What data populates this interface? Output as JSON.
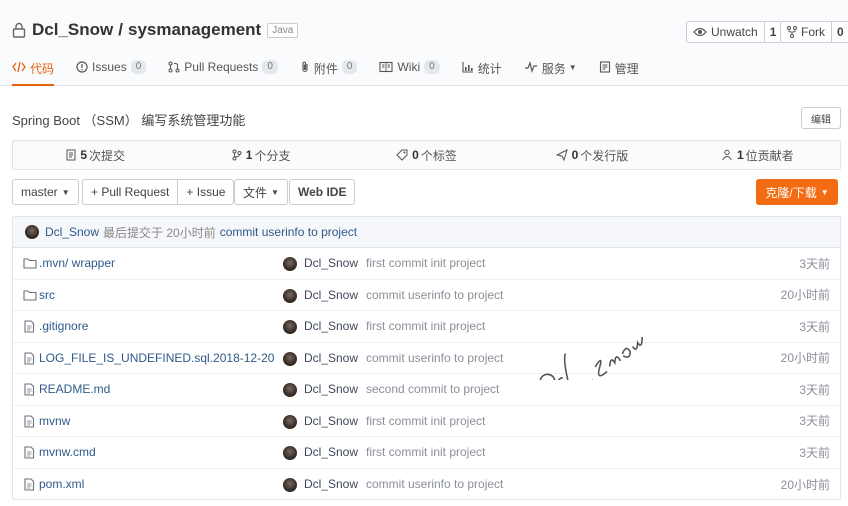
{
  "repo": {
    "owner": "Dcl_Snow",
    "separator": "/",
    "name": "sysmanagement",
    "language": "Java"
  },
  "actions": {
    "watch_label": "Unwatch",
    "watch_count": "1",
    "fork_label": "Fork",
    "fork_count": "0"
  },
  "tabs": [
    {
      "label": "代码",
      "icon": "code-icon"
    },
    {
      "label": "Issues",
      "badge": "0",
      "icon": "issue-icon"
    },
    {
      "label": "Pull Requests",
      "badge": "0",
      "icon": "pull-request-icon"
    },
    {
      "label": "附件",
      "badge": "0",
      "icon": "attachment-icon"
    },
    {
      "label": "Wiki",
      "badge": "0",
      "icon": "wiki-icon"
    },
    {
      "label": "统计",
      "icon": "stats-icon"
    },
    {
      "label": "服务",
      "icon": "service-icon"
    },
    {
      "label": "管理",
      "icon": "manage-icon"
    }
  ],
  "description": "Spring Boot （SSM） 编写系统管理功能",
  "edit_label": "编辑",
  "stats": {
    "commits_num": "5",
    "commits_label": "次提交",
    "branches_num": "1",
    "branches_label": "个分支",
    "tags_num": "0",
    "tags_label": "个标签",
    "releases_num": "0",
    "releases_label": "个发行版",
    "contributors_num": "1",
    "contributors_label": "位贡献者"
  },
  "toolbar": {
    "branch": "master",
    "pull_request": "+ Pull Request",
    "issue": "+ Issue",
    "file": "文件",
    "webide": "Web IDE",
    "clone": "克隆/下载"
  },
  "last_commit": {
    "user": "Dcl_Snow",
    "meta": "最后提交于 20小时前",
    "message": "commit userinfo to project"
  },
  "files": [
    {
      "name": ".mvn/ wrapper",
      "type": "folder",
      "author": "Dcl_Snow",
      "message": "first commit init project",
      "time": "3天前"
    },
    {
      "name": "src",
      "type": "folder",
      "author": "Dcl_Snow",
      "message": "commit userinfo to project",
      "time": "20小时前"
    },
    {
      "name": ".gitignore",
      "type": "file",
      "author": "Dcl_Snow",
      "message": "first commit init project",
      "time": "3天前"
    },
    {
      "name": "LOG_FILE_IS_UNDEFINED.sql.2018-12-20",
      "type": "file",
      "author": "Dcl_Snow",
      "message": "commit userinfo to project",
      "time": "20小时前"
    },
    {
      "name": "README.md",
      "type": "file",
      "author": "Dcl_Snow",
      "message": "second commit to project",
      "time": "3天前"
    },
    {
      "name": "mvnw",
      "type": "file",
      "author": "Dcl_Snow",
      "message": "first commit init project",
      "time": "3天前"
    },
    {
      "name": "mvnw.cmd",
      "type": "file",
      "author": "Dcl_Snow",
      "message": "first commit init project",
      "time": "3天前"
    },
    {
      "name": "pom.xml",
      "type": "file",
      "author": "Dcl_Snow",
      "message": "commit userinfo to project",
      "time": "20小时前"
    }
  ],
  "watermark": "Dcl_Snow",
  "colors": {
    "accent": "#e8600e",
    "clone_button": "#f36c14",
    "link": "#2e5a8a"
  }
}
